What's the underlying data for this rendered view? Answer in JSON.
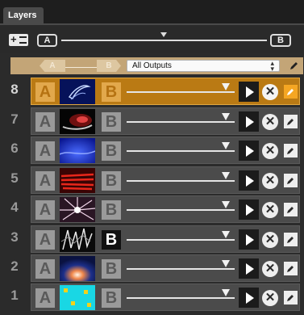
{
  "tabs": [
    {
      "label": "Layers"
    }
  ],
  "master": {
    "a_label": "A",
    "b_label": "B"
  },
  "output": {
    "a_label": "A",
    "b_label": "B",
    "selected": "All Outputs"
  },
  "layers": [
    {
      "number": "8",
      "a_label": "A",
      "b_label": "B"
    },
    {
      "number": "7",
      "a_label": "A",
      "b_label": "B"
    },
    {
      "number": "6",
      "a_label": "A",
      "b_label": "B"
    },
    {
      "number": "5",
      "a_label": "A",
      "b_label": "B"
    },
    {
      "number": "4",
      "a_label": "A",
      "b_label": "B"
    },
    {
      "number": "3",
      "a_label": "A",
      "b_label": "B"
    },
    {
      "number": "2",
      "a_label": "A",
      "b_label": "B"
    },
    {
      "number": "1",
      "a_label": "A",
      "b_label": "B"
    }
  ],
  "colors": {
    "accent": "#ba7a14",
    "output_bar": "#c3a577",
    "background": "#2b2b2b"
  }
}
